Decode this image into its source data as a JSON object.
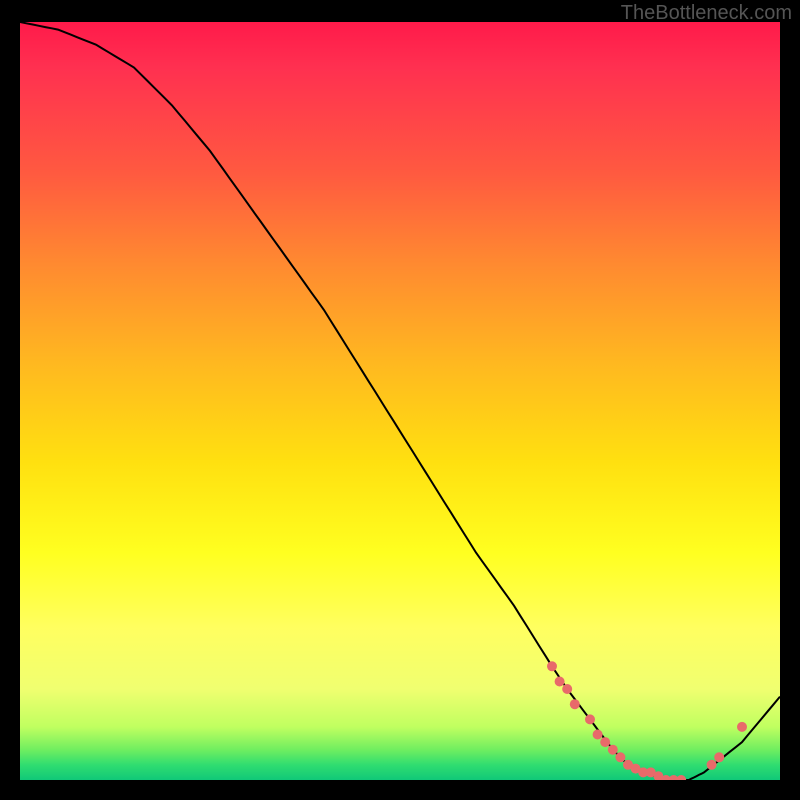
{
  "watermark": "TheBottleneck.com",
  "chart_data": {
    "type": "line",
    "title": "",
    "xlabel": "",
    "ylabel": "",
    "xlim": [
      0,
      100
    ],
    "ylim": [
      0,
      100
    ],
    "x": [
      0,
      5,
      10,
      15,
      20,
      25,
      30,
      35,
      40,
      45,
      50,
      55,
      60,
      65,
      70,
      72,
      75,
      78,
      80,
      82,
      85,
      88,
      90,
      95,
      100
    ],
    "values": [
      100,
      99,
      97,
      94,
      89,
      83,
      76,
      69,
      62,
      54,
      46,
      38,
      30,
      23,
      15,
      12,
      8,
      4,
      2,
      1,
      0,
      0,
      1,
      5,
      11
    ],
    "marker_points_x": [
      70,
      71,
      72,
      73,
      75,
      76,
      77,
      78,
      79,
      80,
      81,
      82,
      83,
      84,
      85,
      86,
      87,
      91,
      92,
      95
    ],
    "marker_points_y": [
      15,
      13,
      12,
      10,
      8,
      6,
      5,
      4,
      3,
      2,
      1.5,
      1,
      1,
      0.5,
      0,
      0,
      0,
      2,
      3,
      7
    ],
    "gradient_colors": {
      "top": "#ff1a4a",
      "mid": "#ffff20",
      "bottom": "#10c878"
    }
  }
}
